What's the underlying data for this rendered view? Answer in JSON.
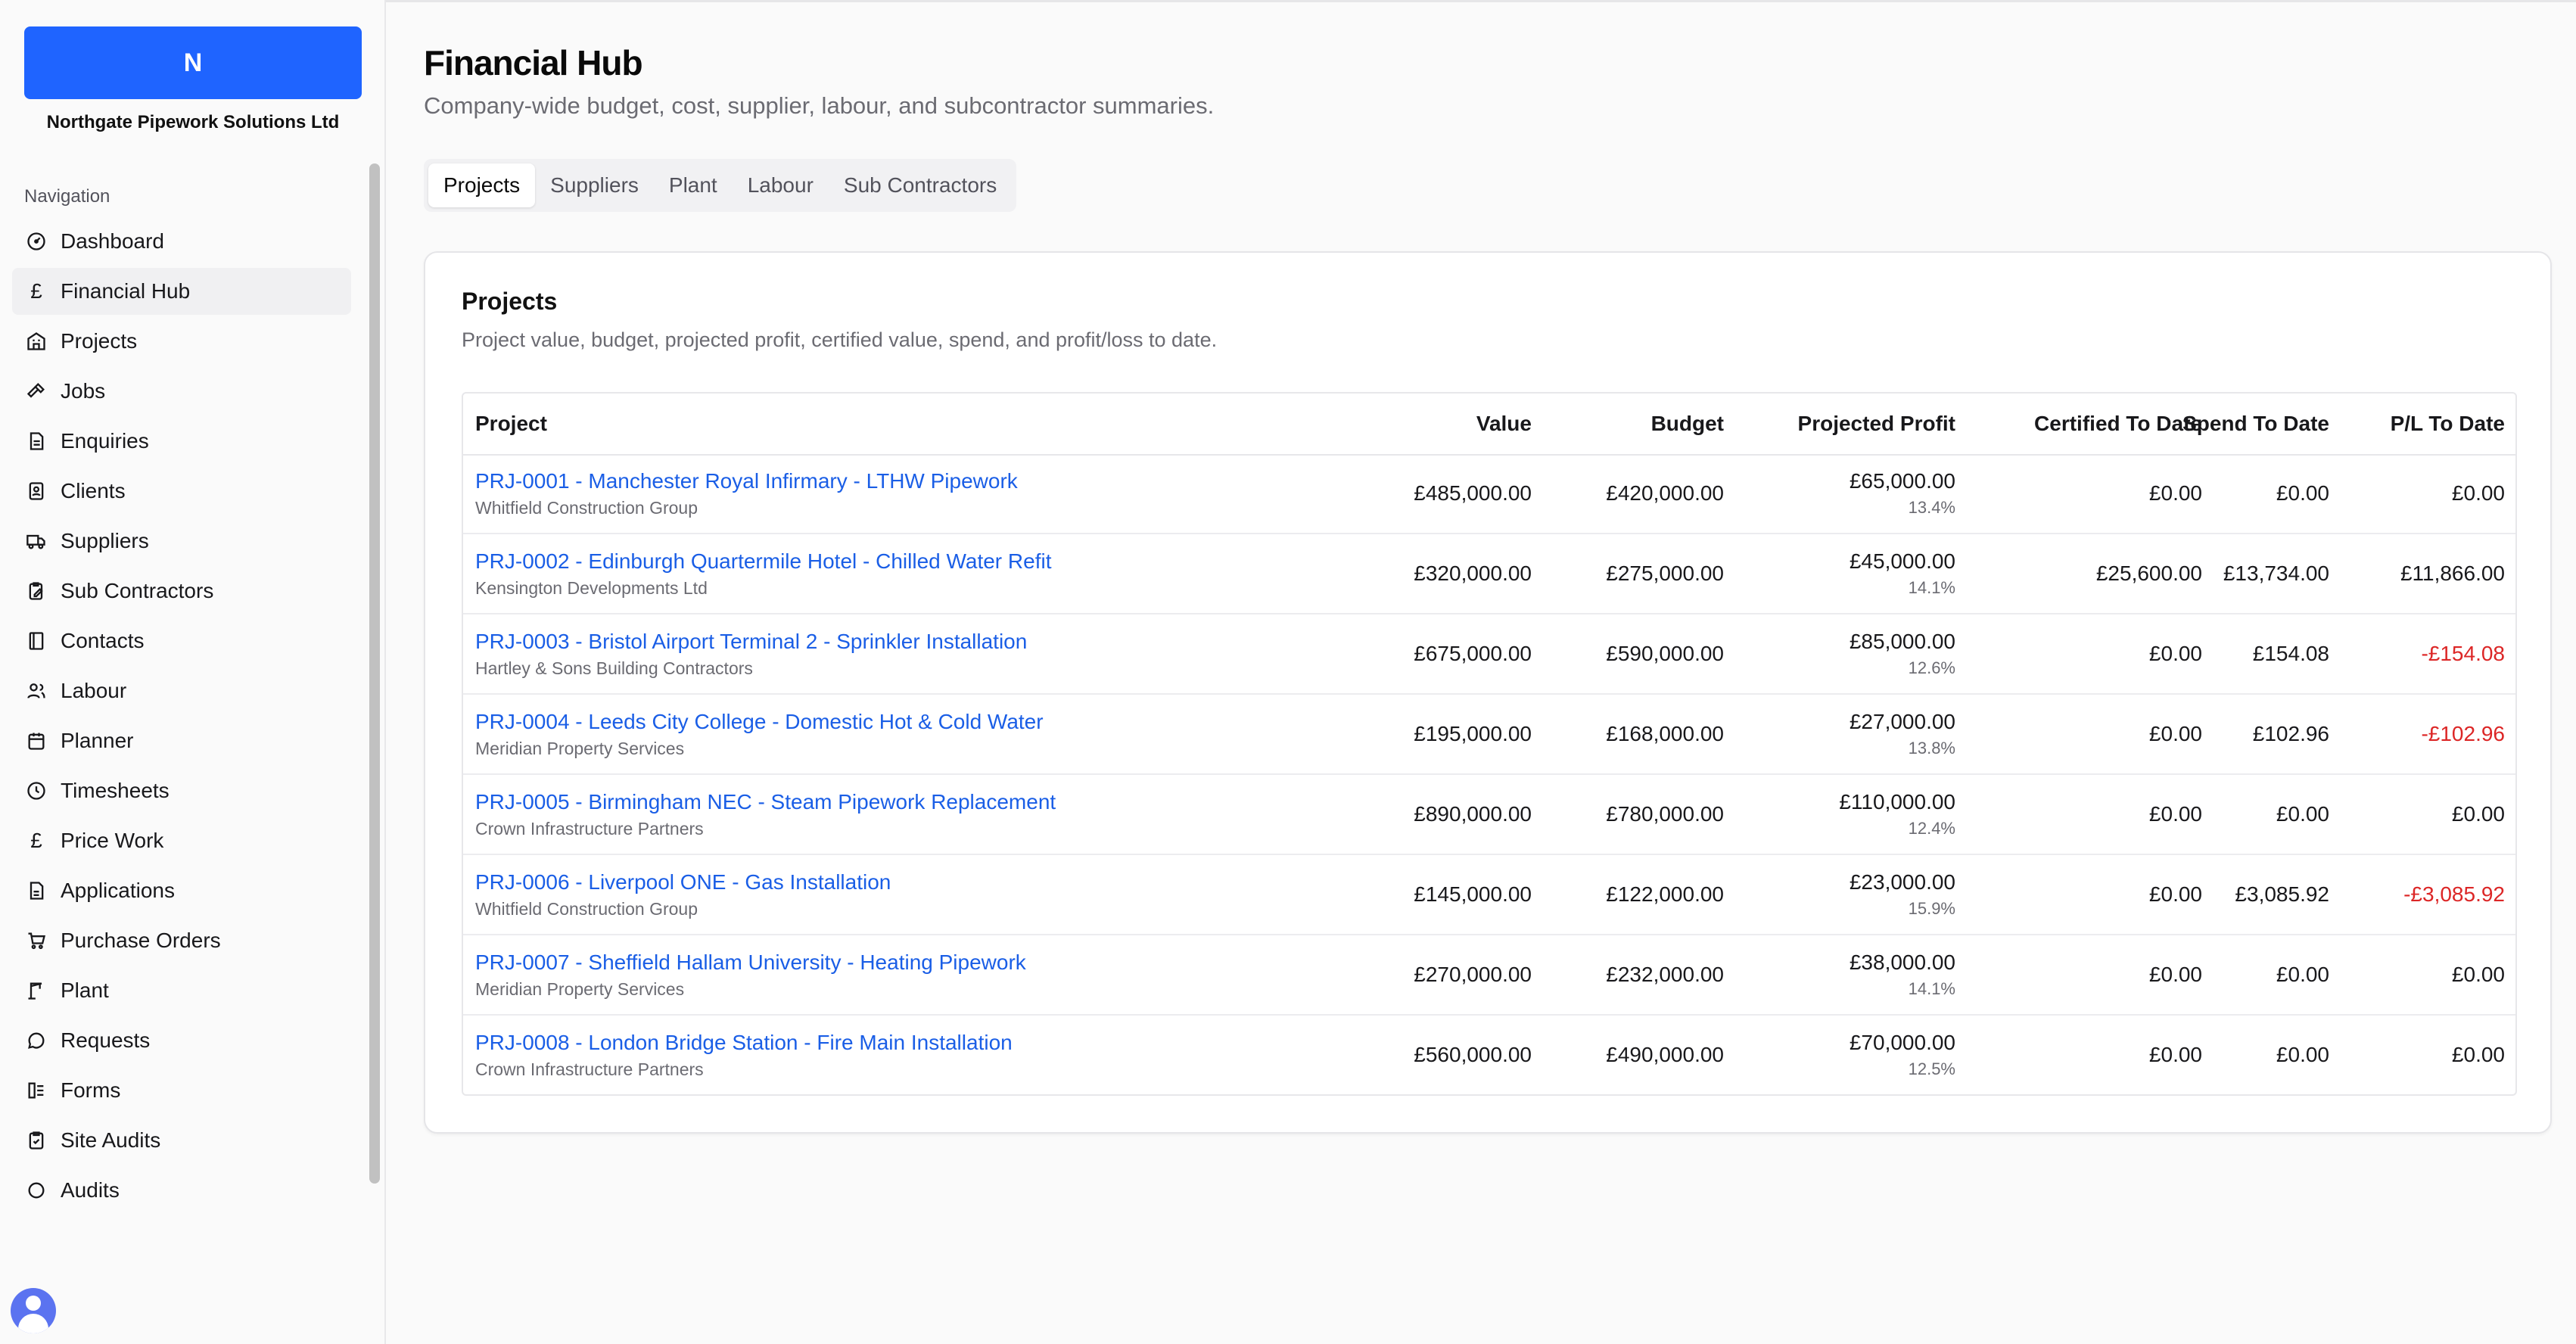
{
  "org": {
    "initial": "N",
    "name": "Northgate Pipework Solutions Ltd"
  },
  "nav": {
    "heading": "Navigation",
    "items": [
      {
        "label": "Dashboard",
        "icon": "dashboard-gauge-icon"
      },
      {
        "label": "Financial Hub",
        "icon": "pound-icon",
        "active": true
      },
      {
        "label": "Projects",
        "icon": "building-icon"
      },
      {
        "label": "Jobs",
        "icon": "hammer-icon"
      },
      {
        "label": "Enquiries",
        "icon": "file-text-icon"
      },
      {
        "label": "Clients",
        "icon": "contact-card-icon"
      },
      {
        "label": "Suppliers",
        "icon": "truck-icon"
      },
      {
        "label": "Sub Contractors",
        "icon": "clipboard-edit-icon"
      },
      {
        "label": "Contacts",
        "icon": "book-icon"
      },
      {
        "label": "Labour",
        "icon": "users-icon"
      },
      {
        "label": "Planner",
        "icon": "calendar-icon"
      },
      {
        "label": "Timesheets",
        "icon": "clock-icon"
      },
      {
        "label": "Price Work",
        "icon": "pound-icon"
      },
      {
        "label": "Applications",
        "icon": "file-icon"
      },
      {
        "label": "Purchase Orders",
        "icon": "cart-icon"
      },
      {
        "label": "Plant",
        "icon": "crane-icon"
      },
      {
        "label": "Requests",
        "icon": "message-icon"
      },
      {
        "label": "Forms",
        "icon": "form-icon"
      },
      {
        "label": "Site Audits",
        "icon": "clipboard-check-icon"
      },
      {
        "label": "Audits",
        "icon": "audit-icon"
      }
    ]
  },
  "page": {
    "title": "Financial Hub",
    "subtitle": "Company-wide budget, cost, supplier, labour, and subcontractor summaries."
  },
  "tabs": [
    "Projects",
    "Suppliers",
    "Plant",
    "Labour",
    "Sub Contractors"
  ],
  "card": {
    "title": "Projects",
    "description": "Project value, budget, projected profit, certified value, spend, and profit/loss to date."
  },
  "table": {
    "columns": [
      "Project",
      "Value",
      "Budget",
      "Projected Profit",
      "Certified To Date",
      "Spend To Date",
      "P/L To Date"
    ],
    "rows": [
      {
        "project": "PRJ-0001 - Manchester Royal Infirmary - LTHW Pipework",
        "client": "Whitfield Construction Group",
        "value": "£485,000.00",
        "budget": "£420,000.00",
        "profit": "£65,000.00",
        "profit_pct": "13.4%",
        "certified": "£0.00",
        "spend": "£0.00",
        "pl": "£0.00",
        "pl_negative": false
      },
      {
        "project": "PRJ-0002 - Edinburgh Quartermile Hotel - Chilled Water Refit",
        "client": "Kensington Developments Ltd",
        "value": "£320,000.00",
        "budget": "£275,000.00",
        "profit": "£45,000.00",
        "profit_pct": "14.1%",
        "certified": "£25,600.00",
        "spend": "£13,734.00",
        "pl": "£11,866.00",
        "pl_negative": false
      },
      {
        "project": "PRJ-0003 - Bristol Airport Terminal 2 - Sprinkler Installation",
        "client": "Hartley & Sons Building Contractors",
        "value": "£675,000.00",
        "budget": "£590,000.00",
        "profit": "£85,000.00",
        "profit_pct": "12.6%",
        "certified": "£0.00",
        "spend": "£154.08",
        "pl": "-£154.08",
        "pl_negative": true
      },
      {
        "project": "PRJ-0004 - Leeds City College - Domestic Hot & Cold Water",
        "client": "Meridian Property Services",
        "value": "£195,000.00",
        "budget": "£168,000.00",
        "profit": "£27,000.00",
        "profit_pct": "13.8%",
        "certified": "£0.00",
        "spend": "£102.96",
        "pl": "-£102.96",
        "pl_negative": true
      },
      {
        "project": "PRJ-0005 - Birmingham NEC - Steam Pipework Replacement",
        "client": "Crown Infrastructure Partners",
        "value": "£890,000.00",
        "budget": "£780,000.00",
        "profit": "£110,000.00",
        "profit_pct": "12.4%",
        "certified": "£0.00",
        "spend": "£0.00",
        "pl": "£0.00",
        "pl_negative": false
      },
      {
        "project": "PRJ-0006 - Liverpool ONE - Gas Installation",
        "client": "Whitfield Construction Group",
        "value": "£145,000.00",
        "budget": "£122,000.00",
        "profit": "£23,000.00",
        "profit_pct": "15.9%",
        "certified": "£0.00",
        "spend": "£3,085.92",
        "pl": "-£3,085.92",
        "pl_negative": true
      },
      {
        "project": "PRJ-0007 - Sheffield Hallam University - Heating Pipework",
        "client": "Meridian Property Services",
        "value": "£270,000.00",
        "budget": "£232,000.00",
        "profit": "£38,000.00",
        "profit_pct": "14.1%",
        "certified": "£0.00",
        "spend": "£0.00",
        "pl": "£0.00",
        "pl_negative": false
      },
      {
        "project": "PRJ-0008 - London Bridge Station - Fire Main Installation",
        "client": "Crown Infrastructure Partners",
        "value": "£560,000.00",
        "budget": "£490,000.00",
        "profit": "£70,000.00",
        "profit_pct": "12.5%",
        "certified": "£0.00",
        "spend": "£0.00",
        "pl": "£0.00",
        "pl_negative": false
      }
    ]
  },
  "colors": {
    "accent": "#1f64ff",
    "link": "#1a5ee6",
    "negative": "#dc2626"
  }
}
